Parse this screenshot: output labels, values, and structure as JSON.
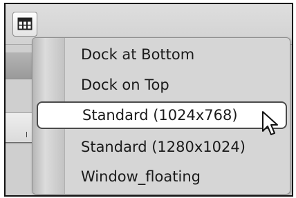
{
  "toolbar": {
    "layout_button_icon": "window-layout-icon"
  },
  "menu": {
    "items": [
      {
        "label": "Dock at Bottom",
        "selected": false
      },
      {
        "label": "Dock on Top",
        "selected": false
      },
      {
        "label": "Standard (1024x768)",
        "selected": true
      },
      {
        "label": "Standard (1280x1024)",
        "selected": false
      },
      {
        "label": "Window_floating",
        "selected": false
      }
    ]
  },
  "cursor": {
    "icon": "mouse-pointer-icon"
  },
  "colors": {
    "menu_background": "#d6d6d6",
    "selected_background": "#ffffff",
    "selected_border": "#4a4a4a"
  }
}
